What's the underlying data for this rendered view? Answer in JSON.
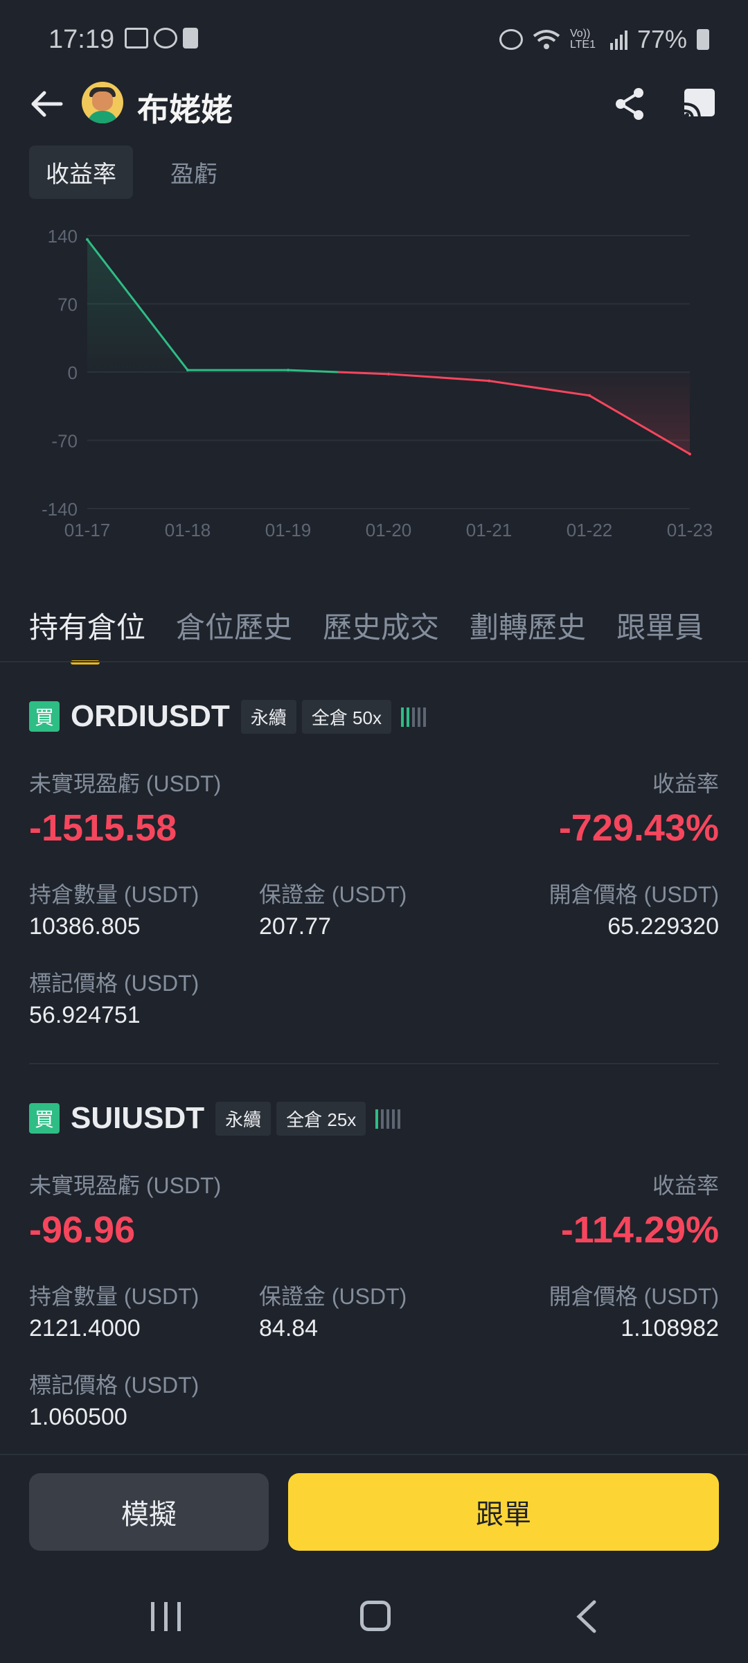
{
  "status_bar": {
    "time": "17:19",
    "battery": "77%",
    "network_label": "Vo)) LTE1"
  },
  "header": {
    "user_name": "布姥姥"
  },
  "chart_tabs": [
    {
      "label": "收益率",
      "active": true
    },
    {
      "label": "盈虧",
      "active": false
    }
  ],
  "chart_data": {
    "type": "line",
    "x": [
      "01-17",
      "01-18",
      "01-19",
      "01-20",
      "01-21",
      "01-22",
      "01-23"
    ],
    "values": [
      136,
      2,
      2,
      -2,
      -9,
      -24,
      -84
    ],
    "yticks": [
      140,
      70,
      0,
      -70,
      -140
    ],
    "ylim": [
      -140,
      140
    ],
    "grid": true,
    "positive_color": "#2ebd85",
    "negative_color": "#f6465d"
  },
  "position_tabs": [
    {
      "label": "持有倉位",
      "active": true
    },
    {
      "label": "倉位歷史",
      "active": false
    },
    {
      "label": "歷史成交",
      "active": false
    },
    {
      "label": "劃轉歷史",
      "active": false
    },
    {
      "label": "跟單員",
      "active": false
    }
  ],
  "labels": {
    "unrealized_pnl": "未實現盈虧 (USDT)",
    "roe": "收益率",
    "position_size": "持倉數量 (USDT)",
    "margin": "保證金 (USDT)",
    "entry_price": "開倉價格 (USDT)",
    "mark_price": "標記價格 (USDT)"
  },
  "positions": [
    {
      "side_badge": "買",
      "symbol": "ORDIUSDT",
      "type_tag": "永續",
      "margin_tag": "全倉 50x",
      "unrealized_pnl": "-1515.58",
      "roe": "-729.43%",
      "position_size": "10386.805",
      "margin": "207.77",
      "entry_price": "65.229320",
      "mark_price": "56.924751"
    },
    {
      "side_badge": "買",
      "symbol": "SUIUSDT",
      "type_tag": "永續",
      "margin_tag": "全倉 25x",
      "unrealized_pnl": "-96.96",
      "roe": "-114.29%",
      "position_size": "2121.4000",
      "margin": "84.84",
      "entry_price": "1.108982",
      "mark_price": "1.060500"
    }
  ],
  "buttons": {
    "simulate": "模擬",
    "copy_trade": "跟單"
  }
}
